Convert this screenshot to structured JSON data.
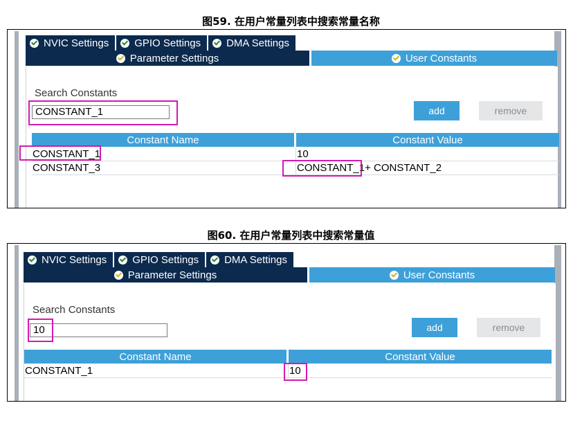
{
  "figures": [
    {
      "caption": "图59. 在用户常量列表中搜索常量名称",
      "tabs": [
        {
          "label": "NVIC Settings",
          "icon": "check-circle-icon"
        },
        {
          "label": "GPIO Settings",
          "icon": "check-circle-icon"
        },
        {
          "label": "DMA Settings",
          "icon": "check-circle-icon"
        }
      ],
      "subtabs": [
        {
          "label": "Parameter Settings",
          "icon": "check-circle-icon"
        },
        {
          "label": "User Constants",
          "icon": "check-circle-icon",
          "active": true
        }
      ],
      "search_label": "Search Constants",
      "search_value": "CONSTANT_1",
      "add_label": "add",
      "remove_label": "remove",
      "columns": [
        "Constant Name",
        "Constant Value"
      ],
      "rows": [
        {
          "name": "CONSTANT_1",
          "value": "10"
        },
        {
          "name": "CONSTANT_3",
          "value": "CONSTANT_1+ CONSTANT_2"
        }
      ]
    },
    {
      "caption": "图60. 在用户常量列表中搜索常量值",
      "tabs": [
        {
          "label": "NVIC Settings",
          "icon": "check-circle-icon"
        },
        {
          "label": "GPIO Settings",
          "icon": "check-circle-icon"
        },
        {
          "label": "DMA Settings",
          "icon": "check-circle-icon"
        }
      ],
      "subtabs": [
        {
          "label": "Parameter Settings",
          "icon": "check-circle-icon"
        },
        {
          "label": "User Constants",
          "icon": "check-circle-icon",
          "active": true
        }
      ],
      "search_label": "Search Constants",
      "search_value": "10",
      "add_label": "add",
      "remove_label": "remove",
      "columns": [
        "Constant Name",
        "Constant Value"
      ],
      "rows": [
        {
          "name": "CONSTANT_1",
          "value": "10"
        }
      ]
    }
  ],
  "colors": {
    "tab_dark": "#0c2a4e",
    "accent_blue": "#3ea0d8",
    "highlight_magenta": "#d21ab0",
    "check_green": "#2a8a2a",
    "check_yellow": "#d4b21a"
  }
}
